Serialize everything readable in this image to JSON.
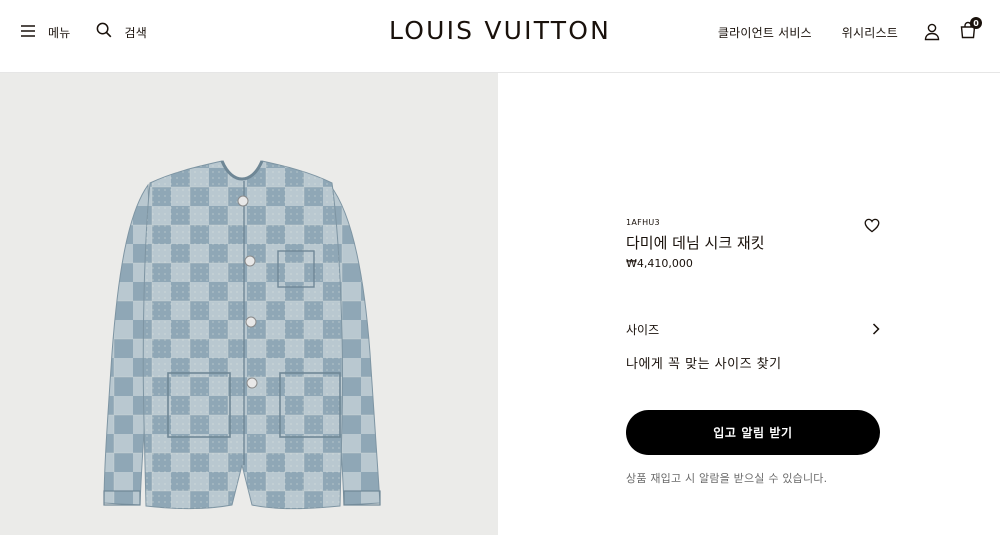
{
  "header": {
    "menu_label": "메뉴",
    "search_label": "검색",
    "brand": "LOUIS VUITTON",
    "client_service": "클라이언트 서비스",
    "wishlist": "위시리스트",
    "bag_count": "0",
    "icons": [
      "menu-icon",
      "search-icon",
      "account-icon",
      "shopping-bag-icon"
    ]
  },
  "product": {
    "sku": "1AFHU3",
    "title": "다미에 데님 시크 재킷",
    "price": "₩4,410,000",
    "size_label": "사이즈",
    "size_guide": "나에게 꼭 맞는 사이즈 찾기",
    "cta_label": "입고 알림 받기",
    "notice": "상품 재입고 시 알람을 받으실 수 있습니다.",
    "icons": [
      "heart-icon",
      "chevron-right-icon"
    ]
  },
  "colors": {
    "text": "#19110b",
    "image_bg": "#ebebe9",
    "cta_bg": "#000000",
    "denim_light": "#b9c9d2",
    "denim_dark": "#8ea6b6"
  }
}
